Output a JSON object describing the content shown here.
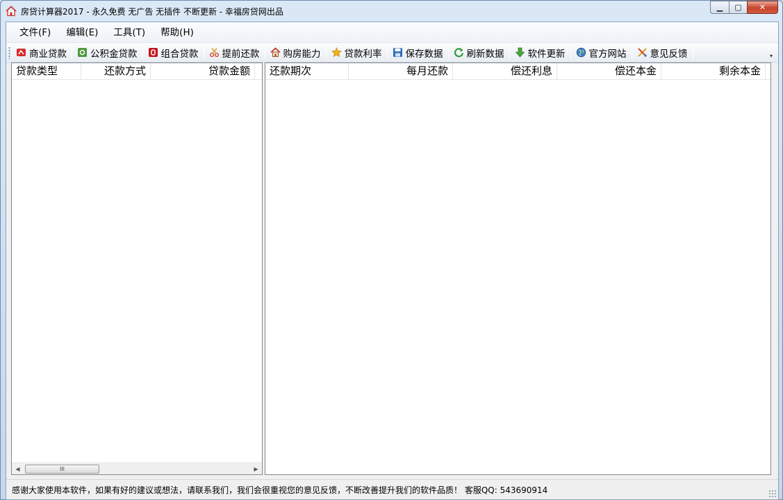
{
  "window": {
    "title": "房贷计算器2017 - 永久免费 无广告 无插件 不断更新 - 幸福房贷网出品",
    "controls": {
      "minimize": "▁",
      "maximize": "▢",
      "close": "✕"
    }
  },
  "menu": [
    {
      "label": "文件(F)"
    },
    {
      "label": "编辑(E)"
    },
    {
      "label": "工具(T)"
    },
    {
      "label": "帮助(H)"
    }
  ],
  "toolbar": [
    {
      "label": "商业贷款",
      "icon": "commercial-loan-icon"
    },
    {
      "label": "公积金贷款",
      "icon": "provident-fund-icon"
    },
    {
      "label": "组合贷款",
      "icon": "combined-loan-icon"
    },
    {
      "label": "提前还款",
      "icon": "scissors-icon"
    },
    {
      "label": "购房能力",
      "icon": "house-icon"
    },
    {
      "label": "贷款利率",
      "icon": "star-icon"
    },
    {
      "label": "保存数据",
      "icon": "save-icon"
    },
    {
      "label": "刷新数据",
      "icon": "refresh-icon"
    },
    {
      "label": "软件更新",
      "icon": "download-arrow-icon"
    },
    {
      "label": "官方网站",
      "icon": "globe-icon"
    },
    {
      "label": "意见反馈",
      "icon": "feedback-icon"
    }
  ],
  "left_table": {
    "columns": [
      "贷款类型",
      "还款方式",
      "贷款金额"
    ]
  },
  "right_table": {
    "columns": [
      "还款期次",
      "每月还款",
      "偿还利息",
      "偿还本金",
      "剩余本金"
    ]
  },
  "scrollbar": {
    "left_arrow": "◀",
    "right_arrow": "▶",
    "thumb_grip": "III"
  },
  "toolbar_overflow": "▾",
  "status": {
    "text": "感谢大家使用本软件，如果有好的建议或想法，请联系我们，我们会很重视您的意见反馈，不断改善提升我们的软件品质！ 客服QQ: 543690914"
  },
  "colors": {
    "accent_red": "#c7442e",
    "titlebar": "#dbe8f6"
  }
}
